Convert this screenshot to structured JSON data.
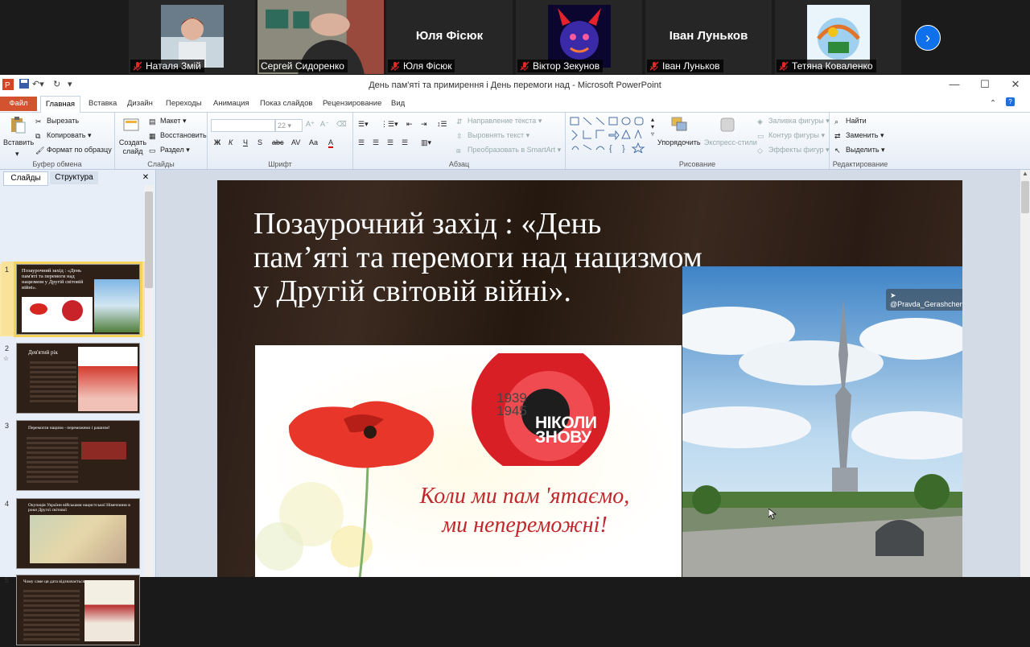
{
  "zoom": {
    "participants": [
      {
        "name": "Наталя Змій",
        "video": true
      },
      {
        "name": "Сергей Сидоренко",
        "video": true,
        "active": true
      },
      {
        "name": "Юля Фісюк",
        "video": false
      },
      {
        "name": "Віктор Зекунов",
        "video": true
      },
      {
        "name": "Іван Луньков",
        "video": false
      },
      {
        "name": "Тетяна  Коваленко",
        "video": true
      }
    ],
    "next_icon": "chevron-right-icon"
  },
  "window": {
    "title": "День пам'яті та примирення і День перемоги над  -  Microsoft PowerPoint",
    "controls": {
      "minimize": "—",
      "maximize": "☐",
      "close": "✕"
    }
  },
  "ribbon": {
    "tabs": [
      "Файл",
      "Главная",
      "Вставка",
      "Дизайн",
      "Переходы",
      "Анимация",
      "Показ слайдов",
      "Рецензирование",
      "Вид"
    ],
    "clipboard": {
      "paste": "Вставить",
      "cut": "Вырезать",
      "copy": "Копировать",
      "format": "Формат по образцу",
      "label": "Буфер обмена"
    },
    "slides": {
      "new": "Создать слайд",
      "layout": "Макет",
      "reset": "Восстановить",
      "section": "Раздел",
      "label": "Слайды"
    },
    "font": {
      "size": "22",
      "label": "Шрифт",
      "buttons": [
        "Ж",
        "К",
        "Ч",
        "S",
        "abc",
        "AV",
        "Aa",
        "A"
      ]
    },
    "paragraph": {
      "direction": "Направление текста",
      "align": "Выровнять текст",
      "smartart": "Преобразовать в SmartArt",
      "label": "Абзац"
    },
    "drawing": {
      "arrange": "Упорядочить",
      "styles": "Экспресс-стили",
      "fill": "Заливка фигуры",
      "outline": "Контур фигуры",
      "effects": "Эффекты фигур",
      "label": "Рисование"
    },
    "editing": {
      "find": "Найти",
      "replace": "Заменить",
      "select": "Выделить",
      "label": "Редактирование"
    }
  },
  "panel": {
    "tabs": [
      "Слайды",
      "Структура"
    ],
    "thumbs": [
      {
        "num": "1",
        "title": "Позаурочний захід : «День пам'яті та перемоги над нацизмом у Другій світовій війні»."
      },
      {
        "num": "2",
        "title": "Дев'ятий рік"
      },
      {
        "num": "3",
        "title": "Перемогли нацизм - переможемо і рашизм!"
      },
      {
        "num": "4",
        "title": "Окупація України військами нацистської Німеччини в роки Другої світової"
      },
      {
        "num": "5",
        "title": "Чому саме ця дата відзначається"
      }
    ]
  },
  "slide": {
    "title": "Позаурочний захід : «День пам’яті та  перемоги над нацизмом у Другій світовій війні».",
    "poppy_years": [
      "1939",
      "1945"
    ],
    "poppy_never": [
      "НІКОЛИ",
      "ЗНОВУ"
    ],
    "caption": [
      "Коли ми пам 'ятаємо,",
      "ми непереможні!"
    ],
    "photo_tag": "@Pravda_Gerashchenko"
  }
}
